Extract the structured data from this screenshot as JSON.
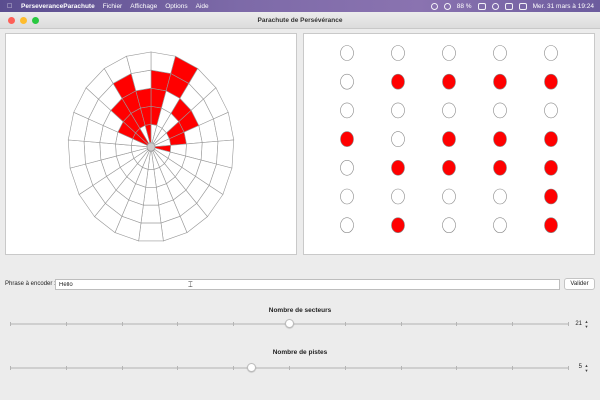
{
  "menubar": {
    "app_name": "PerseveranceParachute",
    "items": [
      "Fichier",
      "Affichage",
      "Options",
      "Aide"
    ],
    "battery": "88 %",
    "datetime": "Mer. 31 mars à  19:24"
  },
  "window": {
    "title": "Parachute de Persévérance"
  },
  "parachute": {
    "sectors": 21,
    "rings": 5,
    "filled_color": "#ff0000",
    "grid_color": "#999999",
    "filled_cells": [
      [
        0,
        1
      ],
      [
        0,
        2
      ],
      [
        0,
        3
      ],
      [
        1,
        3
      ],
      [
        1,
        4
      ],
      [
        2,
        2
      ],
      [
        3,
        1
      ],
      [
        3,
        2
      ],
      [
        4,
        1
      ],
      [
        5,
        0
      ],
      [
        17,
        0
      ],
      [
        17,
        1
      ],
      [
        18,
        0
      ],
      [
        18,
        1
      ],
      [
        18,
        2
      ],
      [
        19,
        1
      ],
      [
        19,
        2
      ],
      [
        19,
        3
      ],
      [
        20,
        0
      ],
      [
        20,
        1
      ],
      [
        20,
        2
      ]
    ]
  },
  "bits_grid": {
    "rows": 7,
    "cols": 5,
    "on_color": "#ff0000",
    "values": [
      [
        0,
        0,
        0,
        0,
        0
      ],
      [
        0,
        1,
        1,
        1,
        1
      ],
      [
        0,
        0,
        0,
        0,
        0
      ],
      [
        1,
        0,
        1,
        1,
        1
      ],
      [
        0,
        1,
        1,
        1,
        1
      ],
      [
        0,
        0,
        0,
        0,
        1
      ],
      [
        0,
        1,
        0,
        0,
        1
      ]
    ]
  },
  "phrase": {
    "label": "Phrase à encoder :",
    "value": "Hello",
    "button": "Valider"
  },
  "sectors_control": {
    "label": "Nombre de secteurs",
    "value": "21",
    "level": 0.5,
    "ticks": 11
  },
  "tracks_control": {
    "label": "Nombre de pistes",
    "value": "5",
    "level": 0.43,
    "ticks": 11
  }
}
